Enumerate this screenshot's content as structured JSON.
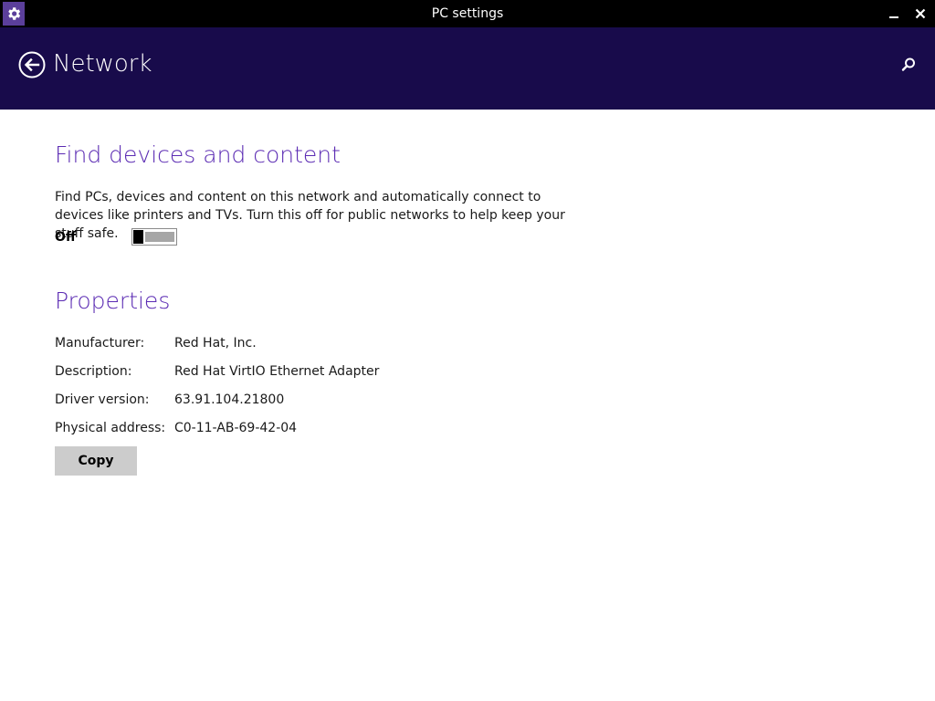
{
  "window": {
    "title": "PC settings",
    "icon": "gear-icon"
  },
  "header": {
    "title": "Network",
    "back_icon": "back-arrow-icon",
    "search_icon": "search-icon",
    "background": "#180b4b"
  },
  "find_devices": {
    "heading": "Find devices and content",
    "description": "Find PCs, devices and content on this network and automatically connect to devices like printers and TVs. Turn this off for public networks to help keep your stuff safe.",
    "toggle_label": "Off",
    "toggle_on": false
  },
  "properties": {
    "heading": "Properties",
    "rows": [
      {
        "label": "Manufacturer:",
        "value": "Red Hat, Inc."
      },
      {
        "label": "Description:",
        "value": "Red Hat VirtIO Ethernet Adapter"
      },
      {
        "label": "Driver version:",
        "value": "63.91.104.21800"
      },
      {
        "label": "Physical address:",
        "value": "C0-11-AB-69-42-04"
      }
    ],
    "copy_label": "Copy"
  },
  "colors": {
    "accent": "#5b2bb3",
    "titlebar": "#000000",
    "button": "#cccccc"
  }
}
